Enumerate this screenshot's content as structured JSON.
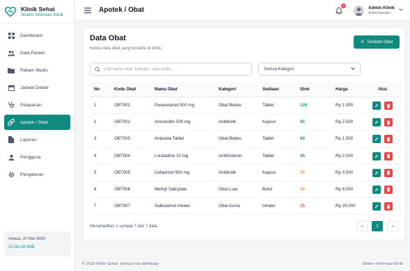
{
  "brand": {
    "name": "Klinik Sehat",
    "subtitle": "Sistem Informasi Klinik",
    "color": "#0d9488"
  },
  "sidebar": {
    "items": [
      {
        "label": "Dashboard",
        "icon": "grid-icon"
      },
      {
        "label": "Data Pasien",
        "icon": "users-icon"
      },
      {
        "label": "Rekam Medis",
        "icon": "folder-icon"
      },
      {
        "label": "Jadwal Dokter",
        "icon": "calendar-icon"
      },
      {
        "label": "Pelayanan",
        "icon": "stethoscope-icon"
      },
      {
        "label": "Apotek / Obat",
        "icon": "pill-icon",
        "active": true
      },
      {
        "label": "Laporan",
        "icon": "document-icon"
      },
      {
        "label": "Pengguna",
        "icon": "user-icon"
      },
      {
        "label": "Pengaturan",
        "icon": "gear-icon"
      }
    ],
    "date": "Selasa, 27 Mei 2025",
    "time": "10:30:24 WIB"
  },
  "topbar": {
    "title": "Apotek / Obat",
    "notification_count": "3",
    "user_name": "Admin Klinik",
    "user_role": "Administrator"
  },
  "card": {
    "title": "Data Obat",
    "subtitle": "Kelola data obat yang tersedia di klinik.",
    "add_button": "Tambah Obat",
    "search_placeholder": "Cari nama obat, kategori, atau kode...",
    "category_select": "Semua Kategori"
  },
  "table": {
    "headers": [
      "No",
      "Kode Obat",
      "Nama Obat",
      "Kategori",
      "Sediaan",
      "Stok",
      "Harga",
      "Aksi"
    ],
    "rows": [
      {
        "no": "1",
        "kode": "OBT001",
        "nama": "Paracetamol 500 mg",
        "kategori": "Obat Bebas",
        "sediaan": "Tablet",
        "stok": "120",
        "stok_level": "green",
        "harga": "Rp 1.000"
      },
      {
        "no": "2",
        "kode": "OBT002",
        "nama": "Amoxicillin 500 mg",
        "kategori": "Antibiotik",
        "sediaan": "Kapsul",
        "stok": "85",
        "stok_level": "green",
        "harga": "Rp 2.500"
      },
      {
        "no": "3",
        "kode": "OBT003",
        "nama": "Antasida Tablet",
        "kategori": "Obat Bebas",
        "sediaan": "Tablet",
        "stok": "60",
        "stok_level": "green",
        "harga": "Rp 1.500"
      },
      {
        "no": "4",
        "kode": "OBT004",
        "nama": "Loratadine 10 mg",
        "kategori": "Antihistamin",
        "sediaan": "Tablet",
        "stok": "45",
        "stok_level": "green",
        "harga": "Rp 2.000"
      },
      {
        "no": "5",
        "kode": "OBT005",
        "nama": "Cefadroxil 500 mg",
        "kategori": "Antibiotik",
        "sediaan": "Kapsul",
        "stok": "30",
        "stok_level": "orange",
        "harga": "Rp 3.000"
      },
      {
        "no": "6",
        "kode": "OBT006",
        "nama": "Methyl Salicylate",
        "kategori": "Obat Luar",
        "sediaan": "Botol",
        "stok": "20",
        "stok_level": "orange",
        "harga": "Rp 8.000"
      },
      {
        "no": "7",
        "kode": "OBT007",
        "nama": "Salbutamol Inhaler",
        "kategori": "Obat Asma",
        "sediaan": "Inhaler",
        "stok": "15",
        "stok_level": "red",
        "harga": "Rp 25.000"
      }
    ]
  },
  "pagination": {
    "showing": "Menampilkan 1 sampai 7 dari 7 data",
    "prev": "«",
    "current": "1",
    "next": "»"
  },
  "footer": {
    "copyright": "© 2025 Klinik Sehat. Semua hak dilindungi.",
    "system": "Sistem Informasi Klinik"
  }
}
